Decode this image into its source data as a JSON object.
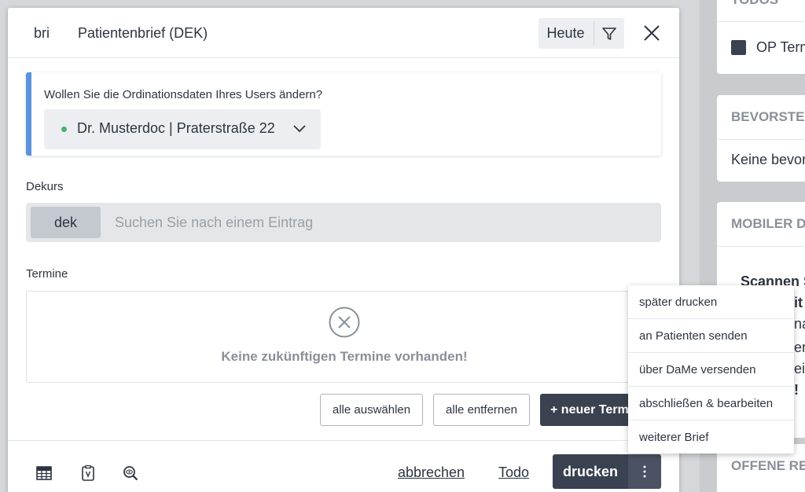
{
  "right_panel": {
    "todos": {
      "header": "TODOS",
      "item": "OP Term"
    },
    "upcoming": {
      "header": "BEVORSTE",
      "body": "Keine bevor"
    },
    "mobile": {
      "header": "MOBILER D",
      "body_lines": [
        "Scannen S",
        "it",
        "na",
        "er",
        "eir",
        "!"
      ]
    },
    "open": {
      "header": "OFFENE RE"
    }
  },
  "modal": {
    "short": "bri",
    "title": "Patientenbrief (DEK)",
    "today_label": "Heute",
    "alert": {
      "question": "Wollen Sie die Ordinationsdaten Ihres Users ändern?",
      "doctor": "Dr. Musterdoc | Praterstraße 22"
    },
    "dekurs": {
      "label": "Dekurs",
      "tag": "dek",
      "placeholder": "Suchen Sie nach einem Eintrag"
    },
    "termine": {
      "label": "Termine",
      "empty_text": "Keine zukünftigen Termine vorhanden!"
    },
    "actions": {
      "select_all": "alle auswählen",
      "remove_all": "alle entfernen",
      "new_appointment": "+ neuer Termin"
    },
    "footer": {
      "cancel": "abbrechen",
      "todo": "Todo",
      "print": "drucken"
    }
  },
  "print_menu": {
    "items": [
      "später drucken",
      "an Patienten senden",
      "über DaMe versenden",
      "abschließen & bearbeiten",
      "weiterer Brief"
    ]
  },
  "colors": {
    "accent_blue": "#5b93dc",
    "dark_button": "#3a4150",
    "status_green": "#4caf6e",
    "muted_text": "#8a9099"
  }
}
